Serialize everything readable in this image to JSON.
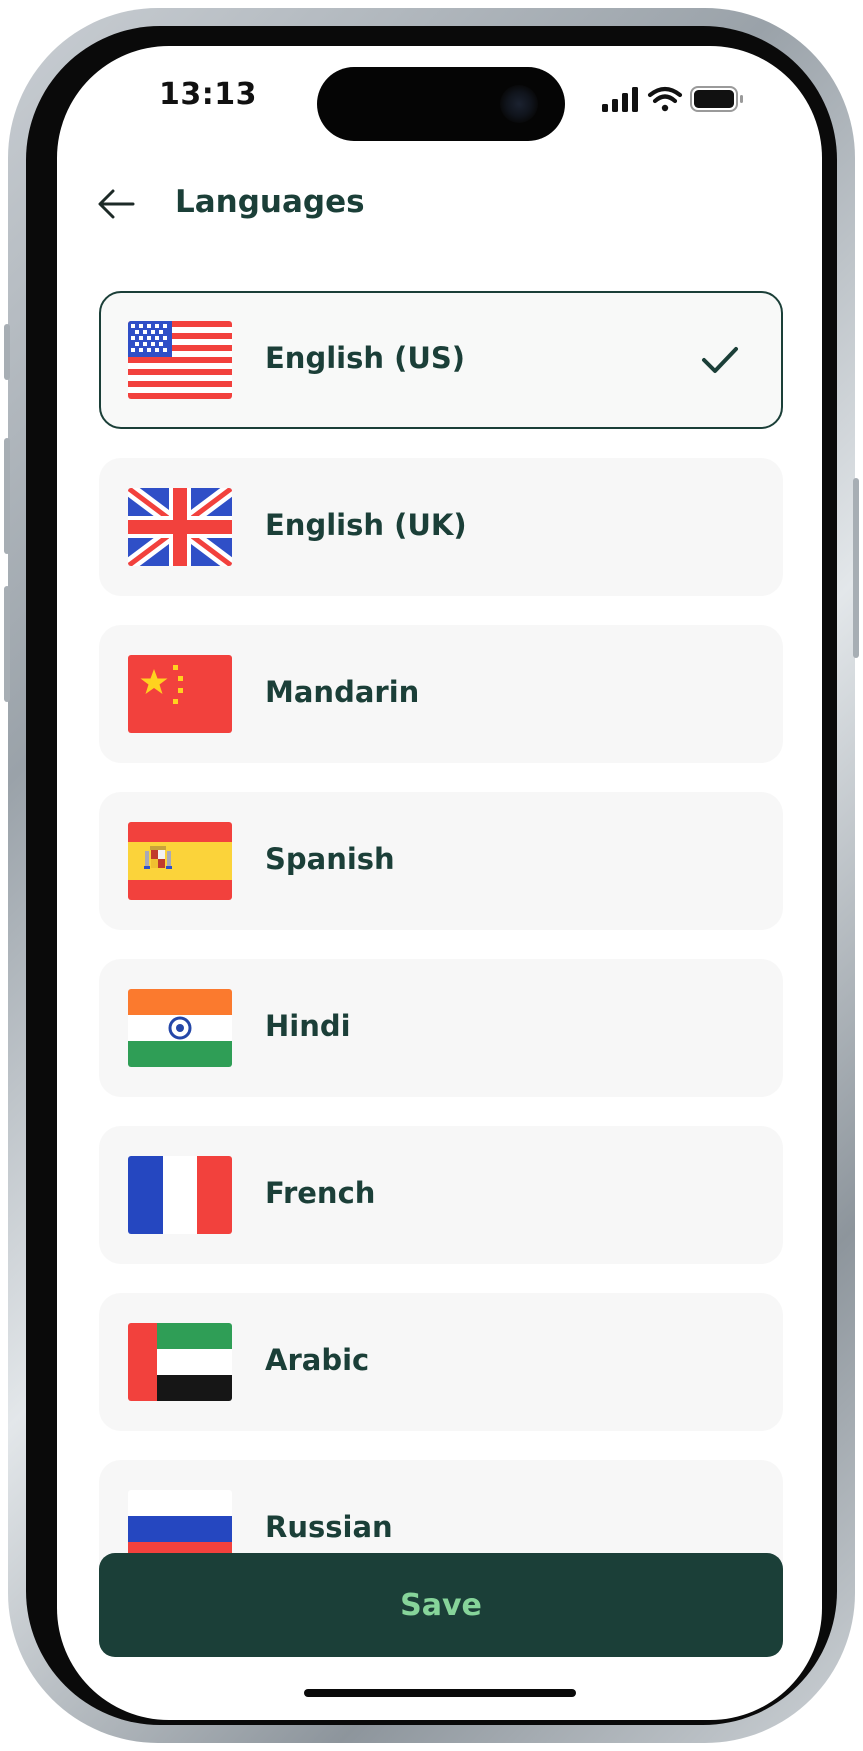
{
  "status_bar": {
    "time": "13:13",
    "icons": [
      "signal-icon",
      "wifi-icon",
      "battery-icon"
    ]
  },
  "header": {
    "title": "Languages",
    "back_icon": "arrow-left-icon"
  },
  "languages": [
    {
      "label": "English (US)",
      "flag": "us-flag-icon",
      "selected": true
    },
    {
      "label": "English (UK)",
      "flag": "uk-flag-icon",
      "selected": false
    },
    {
      "label": "Mandarin",
      "flag": "china-flag-icon",
      "selected": false
    },
    {
      "label": "Spanish",
      "flag": "spain-flag-icon",
      "selected": false
    },
    {
      "label": "Hindi",
      "flag": "india-flag-icon",
      "selected": false
    },
    {
      "label": "French",
      "flag": "france-flag-icon",
      "selected": false
    },
    {
      "label": "Arabic",
      "flag": "uae-flag-icon",
      "selected": false
    },
    {
      "label": "Russian",
      "flag": "russia-flag-icon",
      "selected": false
    }
  ],
  "save_button": {
    "label": "Save"
  },
  "colors": {
    "primary": "#1b3f38",
    "save_text": "#86d49a",
    "item_background": "#f7f7f7"
  }
}
